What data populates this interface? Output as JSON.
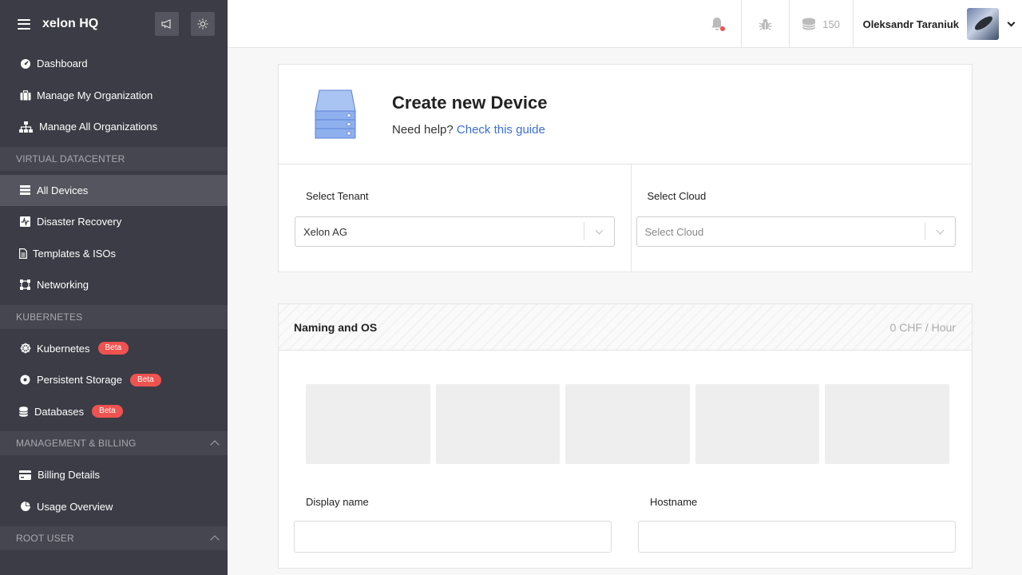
{
  "sidebar": {
    "brand": "xelon HQ",
    "top_items": [
      {
        "label": "Dashboard"
      },
      {
        "label": "Manage My Organization"
      },
      {
        "label": "Manage All Organizations"
      }
    ],
    "sections": [
      {
        "title": "VIRTUAL DATACENTER",
        "items": [
          {
            "label": "All Devices"
          },
          {
            "label": "Disaster Recovery"
          },
          {
            "label": "Templates & ISOs"
          },
          {
            "label": "Networking"
          }
        ]
      },
      {
        "title": "KUBERNETES",
        "items": [
          {
            "label": "Kubernetes",
            "badge": "Beta"
          },
          {
            "label": "Persistent Storage",
            "badge": "Beta"
          },
          {
            "label": "Databases",
            "badge": "Beta"
          }
        ]
      },
      {
        "title": "MANAGEMENT & BILLING",
        "items": [
          {
            "label": "Billing Details"
          },
          {
            "label": "Usage Overview"
          }
        ]
      },
      {
        "title": "ROOT USER"
      }
    ]
  },
  "topbar": {
    "credits": "150",
    "user_name": "Oleksandr Taraniuk"
  },
  "create_card": {
    "title": "Create new Device",
    "help_text": "Need help?",
    "help_link": "Check this guide",
    "tenant_label": "Select Tenant",
    "tenant_value": "Xelon AG",
    "cloud_label": "Select Cloud",
    "cloud_placeholder": "Select Cloud"
  },
  "naming_card": {
    "title": "Naming and OS",
    "price": "0 CHF / Hour",
    "display_name_label": "Display name",
    "hostname_label": "Hostname"
  },
  "colors": {
    "sidebar_bg": "#3c3c46",
    "accent_link": "#3b6fd8",
    "beta_badge": "#ef5350"
  }
}
